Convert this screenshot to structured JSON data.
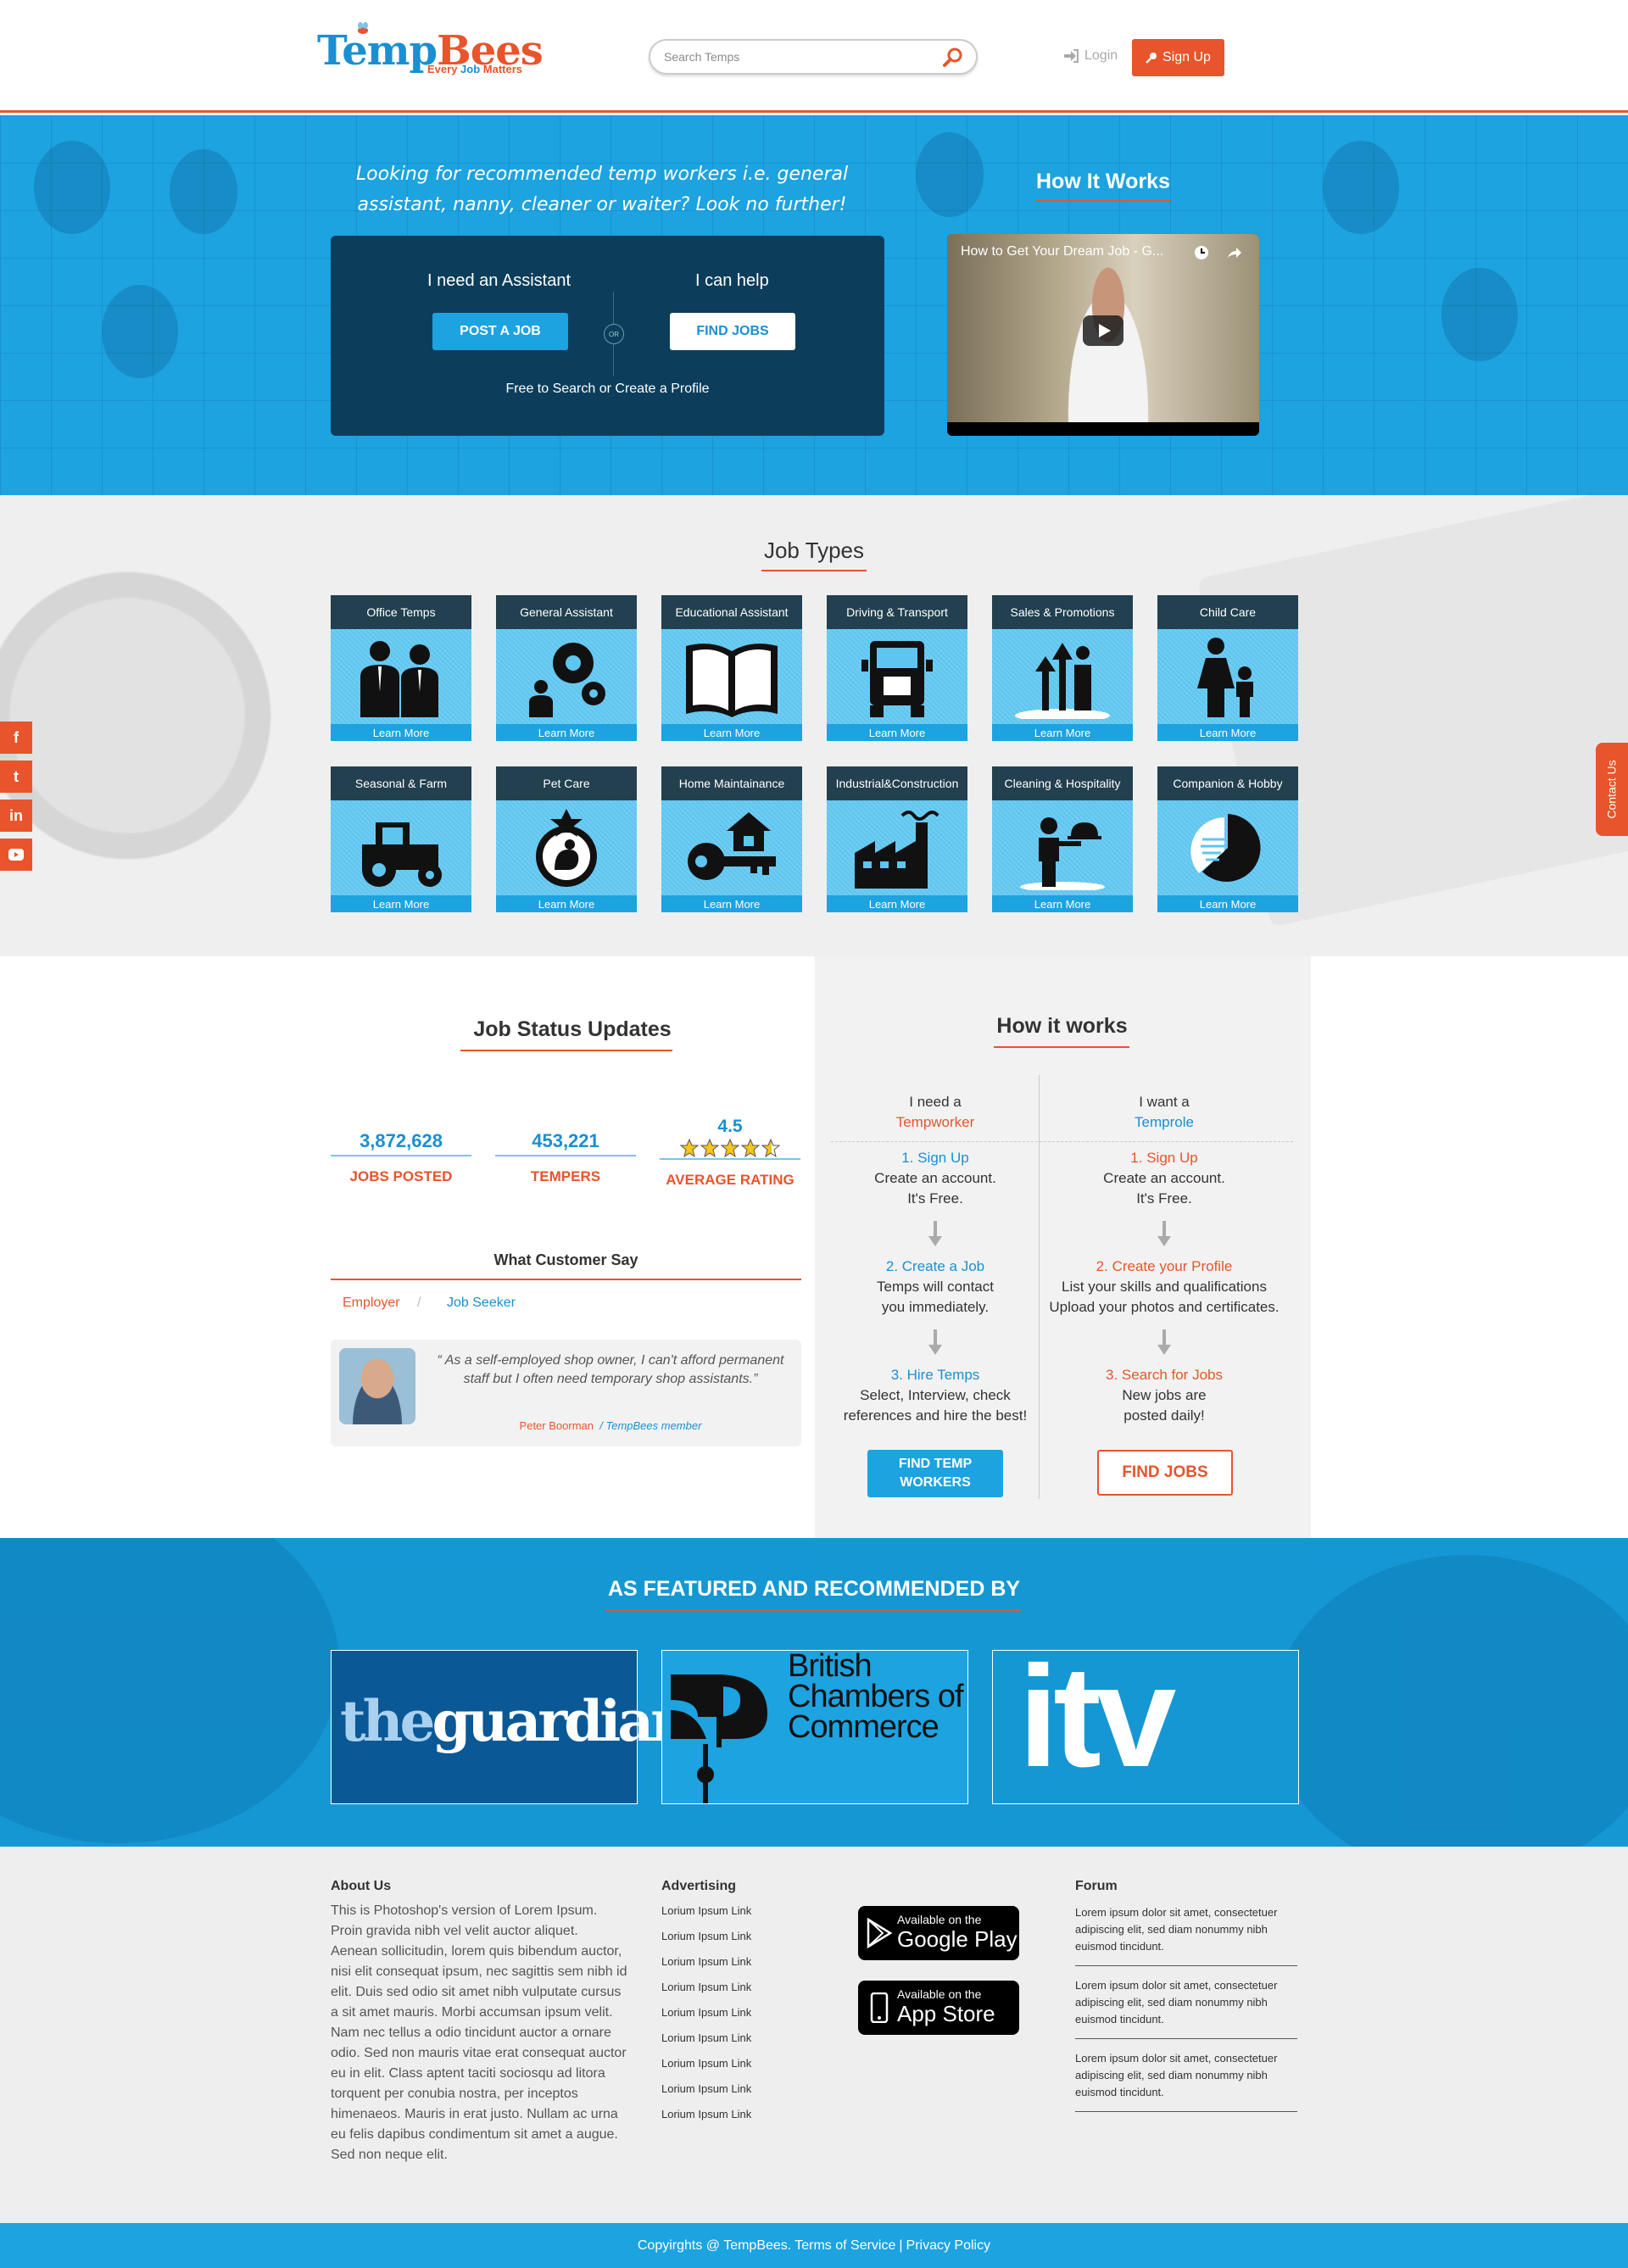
{
  "header": {
    "logo_main": "TempBees",
    "logo_tagline_pre": "Every ",
    "logo_tagline_job": "Job",
    "logo_tagline_post": " Matters",
    "search_placeholder": "Search Temps",
    "login_label": "Login",
    "signup_label": "Sign Up",
    "accent": "#e8542c",
    "brand_blue": "#1ca3e0"
  },
  "hero": {
    "title": "Looking for recommended temp workers i.e. general assistant, nanny, cleaner or waiter? Look no further!",
    "left_label": "I need an Assistant",
    "right_label": "I can help",
    "post_job": "POST A JOB",
    "find_jobs": "FIND JOBS",
    "or": "OR",
    "free_text": "Free to Search or Create a Profile",
    "how_it_works": "How It Works",
    "video_title": "How to Get Your Dream Job - G..."
  },
  "job_types": {
    "title": "Job Types",
    "learn_more": "Learn More",
    "items": [
      {
        "label": "Office Temps",
        "icon": "office-people-icon"
      },
      {
        "label": "General Assistant",
        "icon": "gears-icon"
      },
      {
        "label": "Educational Assistant",
        "icon": "book-icon"
      },
      {
        "label": "Driving & Transport",
        "icon": "truck-icon"
      },
      {
        "label": "Sales & Promotions",
        "icon": "growth-person-icon"
      },
      {
        "label": "Child Care",
        "icon": "mother-child-icon"
      },
      {
        "label": "Seasonal & Farm",
        "icon": "tractor-icon"
      },
      {
        "label": "Pet Care",
        "icon": "pet-badge-icon"
      },
      {
        "label": "Home Maintainance",
        "icon": "house-key-icon"
      },
      {
        "label": "Industrial&Construction",
        "icon": "factory-icon"
      },
      {
        "label": "Cleaning & Hospitality",
        "icon": "waiter-icon"
      },
      {
        "label": "Companion & Hobby",
        "icon": "pie-icon"
      }
    ]
  },
  "social": [
    "f",
    "t",
    "in",
    "yt"
  ],
  "contact_us": "Contact Us",
  "job_status": {
    "title": "Job Status Updates",
    "stats": [
      {
        "value": "3,872,628",
        "label": "JOBS POSTED"
      },
      {
        "value": "453,221",
        "label": "TEMPERS"
      },
      {
        "value": "4.5",
        "label": "AVERAGE RATING",
        "stars": 5
      }
    ],
    "customer_title": "What Customer Say",
    "tab_employer": "Employer",
    "tab_sep": "/",
    "tab_jobseeker": "Job Seeker",
    "quote": "As a self-employed shop owner, I can't afford permanent staff but I often need temporary shop assistants.",
    "quote_open": "“",
    "quote_close": "”",
    "author": "Peter Boorman",
    "author_sep": "/",
    "author_role": "TempBees member"
  },
  "how_it_works": {
    "title": "How it works",
    "left_head_a": "I need a",
    "left_head_b": "Tempworker",
    "right_head_a": "I want a",
    "right_head_b": "Temprole",
    "left_steps": [
      {
        "title": "1. Sign Up",
        "l1": "Create an account.",
        "l2": "It's Free."
      },
      {
        "title": "2. Create a Job",
        "l1": "Temps will contact",
        "l2": "you immediately."
      },
      {
        "title": "3. Hire Temps",
        "l1": "Select, Interview, check",
        "l2": "references and hire the best!"
      }
    ],
    "right_steps": [
      {
        "title": "1. Sign Up",
        "l1": "Create an account.",
        "l2": "It's Free."
      },
      {
        "title": "2. Create your Profile",
        "l1": "List your skills and qualifications",
        "l2": "Upload your photos and certificates."
      },
      {
        "title": "3. Search for Jobs",
        "l1": "New jobs are",
        "l2": "posted daily!"
      }
    ],
    "btn_left": "FIND TEMP WORKERS",
    "btn_right": "FIND JOBS"
  },
  "featured": {
    "title": "AS FEATURED AND RECOMMENDED BY",
    "guardian_a": "the",
    "guardian_b": "guardian",
    "bcc_l1": "British",
    "bcc_l2": "Chambers of",
    "bcc_l3": "Commerce",
    "itv": "itv"
  },
  "footer": {
    "about_title": "About Us",
    "about_text": "This is Photoshop's version of Lorem Ipsum. Proin gravida nibh vel velit auctor aliquet. Aenean sollicitudin, lorem quis bibendum auctor, nisi elit consequat ipsum, nec sagittis sem nibh id elit. Duis sed odio sit amet nibh vulputate cursus a sit amet mauris. Morbi accumsan ipsum velit. Nam nec tellus a odio tincidunt auctor a ornare odio. Sed non mauris vitae erat consequat auctor eu in elit. Class aptent taciti sociosqu ad litora torquent per conubia nostra, per inceptos himenaeos. Mauris in erat justo. Nullam ac urna eu felis dapibus condimentum sit amet a augue. Sed non neque elit.",
    "advertising_title": "Advertising",
    "advertising_links": [
      "Lorium Ipsum Link",
      "Lorium Ipsum Link",
      "Lorium Ipsum Link",
      "Lorium Ipsum Link",
      "Lorium Ipsum Link",
      "Lorium Ipsum Link",
      "Lorium Ipsum Link",
      "Lorium Ipsum Link",
      "Lorium Ipsum Link"
    ],
    "google_a": "Available on the",
    "google_b": "Google Play",
    "apple_a": "Available on the",
    "apple_b": "App Store",
    "forum_title": "Forum",
    "forum_items": [
      "Lorem ipsum dolor sit amet, consectetuer adipiscing elit, sed diam nonummy nibh euismod tincidunt.",
      "Lorem ipsum dolor sit amet, consectetuer adipiscing elit, sed diam nonummy nibh euismod tincidunt.",
      "Lorem ipsum dolor sit amet, consectetuer adipiscing elit, sed diam nonummy nibh euismod tincidunt."
    ],
    "copyright": "Copyirghts @ TempBees.",
    "terms": "Terms of Service",
    "sep": "|",
    "privacy": "Privacy Policy"
  }
}
